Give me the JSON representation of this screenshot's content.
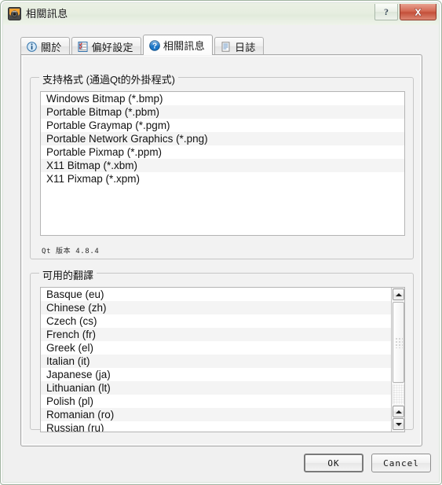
{
  "window": {
    "title": "相關訊息",
    "icon": "app-icon",
    "help_button_label": "?",
    "close_button_label": "✕"
  },
  "tabs": [
    {
      "label": "關於",
      "icon": "info-icon",
      "active": false
    },
    {
      "label": "偏好設定",
      "icon": "checklist-icon",
      "active": false
    },
    {
      "label": "相關訊息",
      "icon": "question-icon",
      "active": true
    },
    {
      "label": "日誌",
      "icon": "document-icon",
      "active": false
    }
  ],
  "formats_group": {
    "title": "支持格式 (通過Qt的外掛程式)",
    "items": [
      "Windows Bitmap (*.bmp)",
      "Portable Bitmap (*.pbm)",
      "Portable Graymap (*.pgm)",
      "Portable Network Graphics (*.png)",
      "Portable Pixmap (*.ppm)",
      "X11 Bitmap (*.xbm)",
      "X11 Pixmap (*.xpm)"
    ],
    "qt_version": "Qt 版本 4.8.4"
  },
  "translations_group": {
    "title": "可用的翻譯",
    "items": [
      "Basque (eu)",
      "Chinese (zh)",
      "Czech (cs)",
      "French (fr)",
      "Greek (el)",
      "Italian (it)",
      "Japanese (ja)",
      "Lithuanian (lt)",
      "Polish (pl)",
      "Romanian (ro)",
      "Russian (ru)"
    ]
  },
  "buttons": {
    "ok": "OK",
    "cancel": "Cancel"
  },
  "colors": {
    "close_red": "#c4503a",
    "accent_blue": "#1b76c8",
    "titlebar_green": "#e6eee0"
  }
}
